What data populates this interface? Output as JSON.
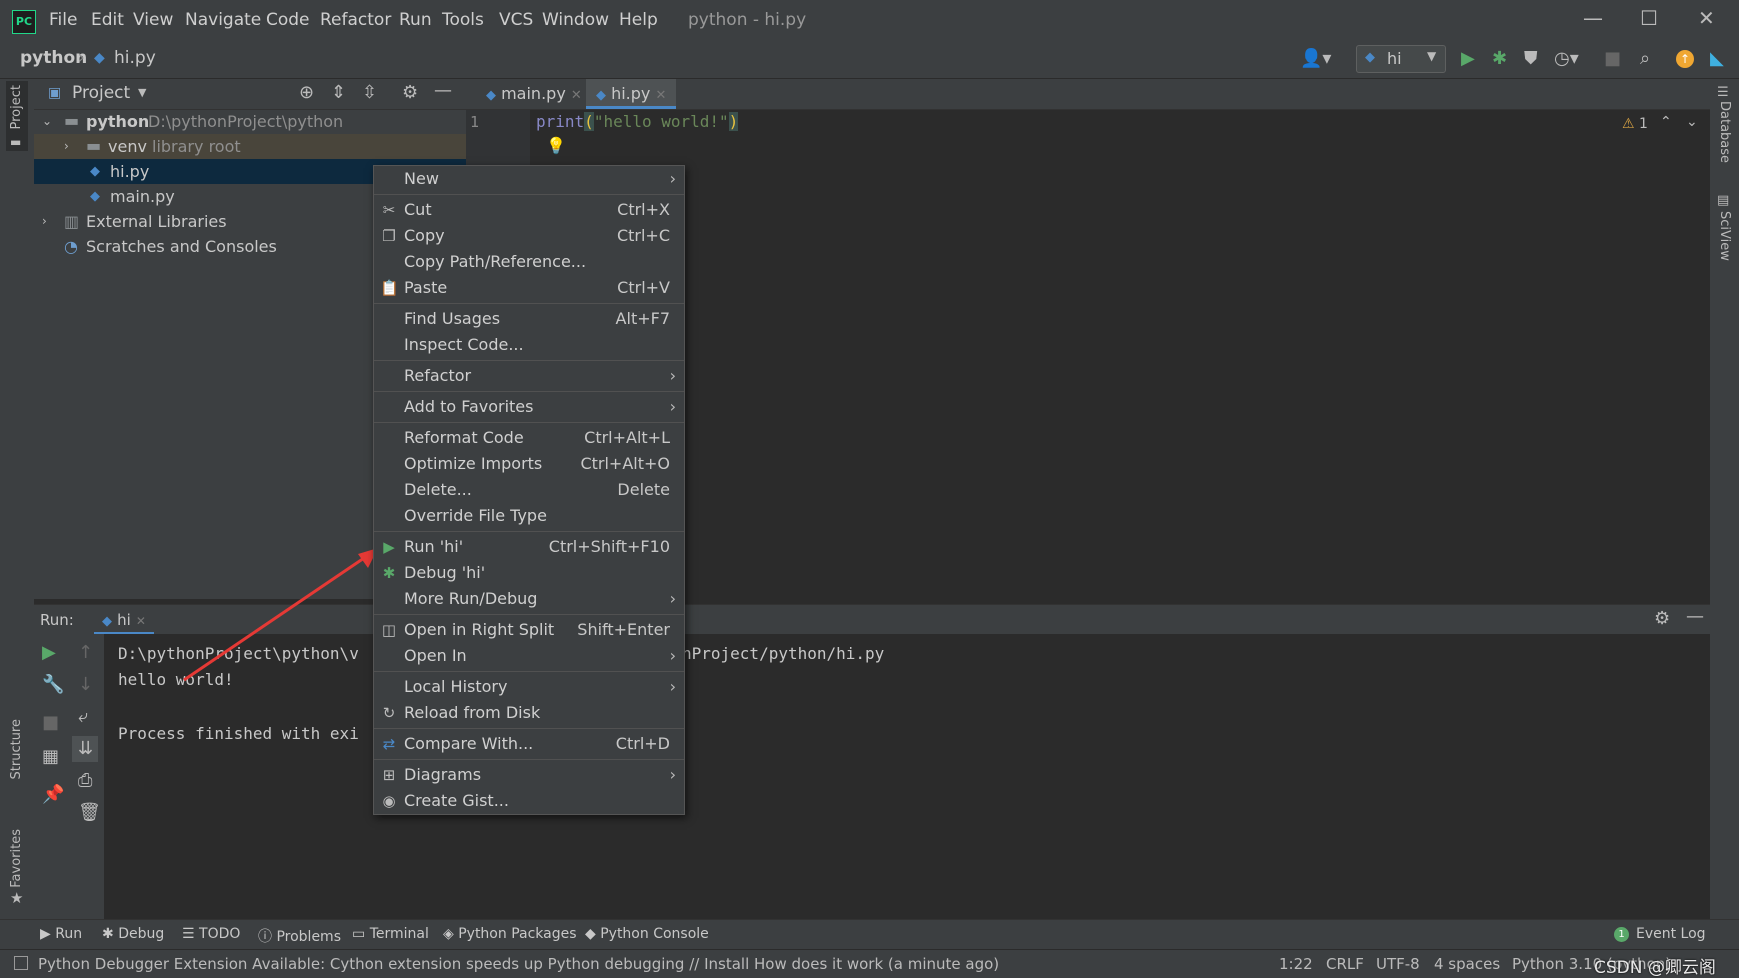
{
  "window": {
    "title": "python - hi.py",
    "menu": [
      "File",
      "Edit",
      "View",
      "Navigate",
      "Code",
      "Refactor",
      "Run",
      "Tools",
      "VCS",
      "Window",
      "Help"
    ]
  },
  "nav": {
    "breadcrumb_root": "python",
    "breadcrumb_file": "hi.py",
    "run_config": "hi"
  },
  "left_strip": {
    "project": "Project",
    "structure": "Structure",
    "favorites": "Favorites"
  },
  "right_strip": {
    "database": "Database",
    "sciview": "SciView"
  },
  "project_panel": {
    "title": "Project",
    "tree": [
      {
        "name": "python",
        "extra": "D:\\pythonProject\\python"
      },
      {
        "name": "venv",
        "extra": "library root"
      },
      {
        "name": "hi.py",
        "extra": ""
      },
      {
        "name": "main.py",
        "extra": ""
      },
      {
        "name": "External Libraries",
        "extra": ""
      },
      {
        "name": "Scratches and Consoles",
        "extra": ""
      }
    ]
  },
  "editor": {
    "tabs": [
      "main.py",
      "hi.py"
    ],
    "line_number": "1",
    "code_fn": "print",
    "code_open": "(",
    "code_str": "\"hello world!\"",
    "code_close": ")",
    "warnings": "1"
  },
  "run_panel": {
    "label": "Run:",
    "tab": "hi",
    "lines": [
      "D:\\pythonProject\\python\\v",
      "hello world!",
      "",
      "Process finished with exi"
    ],
    "line1_tail": "nProject/python/hi.py"
  },
  "context_menu": {
    "items": [
      {
        "label": "New",
        "shortcut": "",
        "submenu": true,
        "icon": ""
      },
      {
        "sep": true
      },
      {
        "label": "Cut",
        "shortcut": "Ctrl+X",
        "icon": "✂"
      },
      {
        "label": "Copy",
        "shortcut": "Ctrl+C",
        "icon": "❐"
      },
      {
        "label": "Copy Path/Reference...",
        "shortcut": "",
        "icon": ""
      },
      {
        "label": "Paste",
        "shortcut": "Ctrl+V",
        "icon": "📋"
      },
      {
        "sep": true
      },
      {
        "label": "Find Usages",
        "shortcut": "Alt+F7",
        "icon": ""
      },
      {
        "label": "Inspect Code...",
        "shortcut": "",
        "icon": ""
      },
      {
        "sep": true
      },
      {
        "label": "Refactor",
        "shortcut": "",
        "submenu": true,
        "icon": ""
      },
      {
        "sep": true
      },
      {
        "label": "Add to Favorites",
        "shortcut": "",
        "submenu": true,
        "icon": ""
      },
      {
        "sep": true
      },
      {
        "label": "Reformat Code",
        "shortcut": "Ctrl+Alt+L",
        "icon": ""
      },
      {
        "label": "Optimize Imports",
        "shortcut": "Ctrl+Alt+O",
        "icon": ""
      },
      {
        "label": "Delete...",
        "shortcut": "Delete",
        "icon": ""
      },
      {
        "label": "Override File Type",
        "shortcut": "",
        "icon": ""
      },
      {
        "sep": true
      },
      {
        "label": "Run 'hi'",
        "shortcut": "Ctrl+Shift+F10",
        "icon": "▶"
      },
      {
        "label": "Debug 'hi'",
        "shortcut": "",
        "icon": "✱"
      },
      {
        "label": "More Run/Debug",
        "shortcut": "",
        "submenu": true,
        "icon": ""
      },
      {
        "sep": true
      },
      {
        "label": "Open in Right Split",
        "shortcut": "Shift+Enter",
        "icon": "◫"
      },
      {
        "label": "Open In",
        "shortcut": "",
        "submenu": true,
        "icon": ""
      },
      {
        "sep": true
      },
      {
        "label": "Local History",
        "shortcut": "",
        "submenu": true,
        "icon": ""
      },
      {
        "label": "Reload from Disk",
        "shortcut": "",
        "icon": "↻"
      },
      {
        "sep": true
      },
      {
        "label": "Compare With...",
        "shortcut": "Ctrl+D",
        "icon": "⇄"
      },
      {
        "sep": true
      },
      {
        "label": "Diagrams",
        "shortcut": "",
        "submenu": true,
        "icon": "⊞"
      },
      {
        "label": "Create Gist...",
        "shortcut": "",
        "icon": "◉"
      }
    ]
  },
  "bottom_tabs": [
    "Run",
    "Debug",
    "TODO",
    "Problems",
    "Terminal",
    "Python Packages",
    "Python Console"
  ],
  "event_log": "Event Log",
  "event_count": "1",
  "status": {
    "message": "Python Debugger Extension Available: Cython extension speeds up Python debugging // Install   How does it work (a minute ago)",
    "position": "1:22",
    "line_sep": "CRLF",
    "encoding": "UTF-8",
    "indent": "4 spaces",
    "interpreter": "Python 3.10 (python)",
    "watermark": "CSDN @卿云阁"
  },
  "colors": {
    "accent": "#4a88c7",
    "run_green": "#59a869",
    "keyword": "#cc7832",
    "string": "#6a8759",
    "arrow_red": "#e53935"
  }
}
